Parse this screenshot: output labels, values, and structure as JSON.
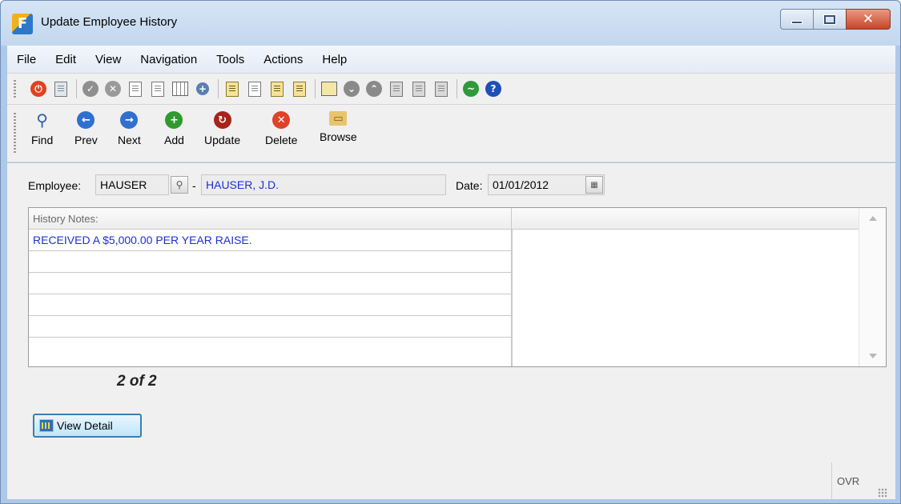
{
  "window": {
    "title": "Update Employee History",
    "app_icon_letter": "F"
  },
  "menubar": {
    "items": [
      "File",
      "Edit",
      "View",
      "Navigation",
      "Tools",
      "Actions",
      "Help"
    ]
  },
  "toolbar_icons": [
    "power-icon",
    "save-icon",
    "check-icon",
    "cancel-icon",
    "copy-doc-icon",
    "paste-doc-icon",
    "grid-doc-icon",
    "zoom-icon",
    "notes-icon",
    "attach-icon",
    "doc-user-icon",
    "calendar-icon",
    "transfer-icon",
    "down-circle-icon",
    "up-circle-icon",
    "move-left-icon",
    "move-right-icon",
    "sort-icon",
    "chart-icon",
    "help-icon"
  ],
  "navbar": {
    "find": "Find",
    "prev": "Prev",
    "next": "Next",
    "add": "Add",
    "update": "Update",
    "delete": "Delete",
    "browse": "Browse"
  },
  "form": {
    "employee_label": "Employee:",
    "employee_code": "HAUSER",
    "separator": "-",
    "employee_name": "HAUSER, J.D.",
    "date_label": "Date:",
    "date_value": "01/01/2012"
  },
  "history": {
    "header": "History Notes:",
    "rows": [
      "RECEIVED A $5,000.00 PER YEAR RAISE.",
      "",
      "",
      "",
      "",
      ""
    ]
  },
  "record_count": "2 of 2",
  "view_detail_label": "View Detail",
  "status": {
    "mode": "OVR"
  },
  "colors": {
    "accent_blue": "#1e2fd6",
    "close_red": "#c7442a",
    "toolbar_bg": "#f0f0f0"
  }
}
